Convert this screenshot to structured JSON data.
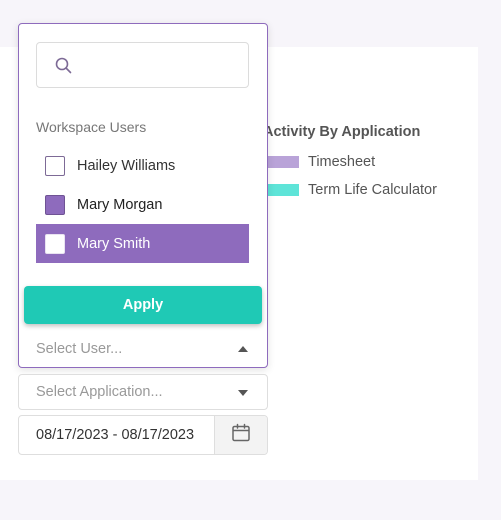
{
  "chart": {
    "title": "Activity By Application",
    "legend": [
      {
        "label": "Timesheet",
        "color": "#b9a3d8"
      },
      {
        "label": "Term Life Calculator",
        "color": "#5ee4d8"
      }
    ]
  },
  "user_dropdown": {
    "search_value": "",
    "group_title": "Workspace Users",
    "options": [
      {
        "label": "Hailey Williams",
        "checked": false,
        "highlighted": false
      },
      {
        "label": "Mary Morgan",
        "checked": true,
        "highlighted": false
      },
      {
        "label": "Mary Smith",
        "checked": false,
        "highlighted": true
      }
    ],
    "apply_label": "Apply",
    "placeholder": "Select User..."
  },
  "application_select": {
    "placeholder": "Select Application..."
  },
  "date_range": {
    "value": "08/17/2023 - 08/17/2023"
  },
  "colors": {
    "accent": "#8e6bbd",
    "apply": "#1fc9b5"
  },
  "icons": {
    "search": "search-icon",
    "calendar": "calendar-icon",
    "caret_up": "caret-up-icon",
    "caret_down": "caret-down-icon"
  }
}
